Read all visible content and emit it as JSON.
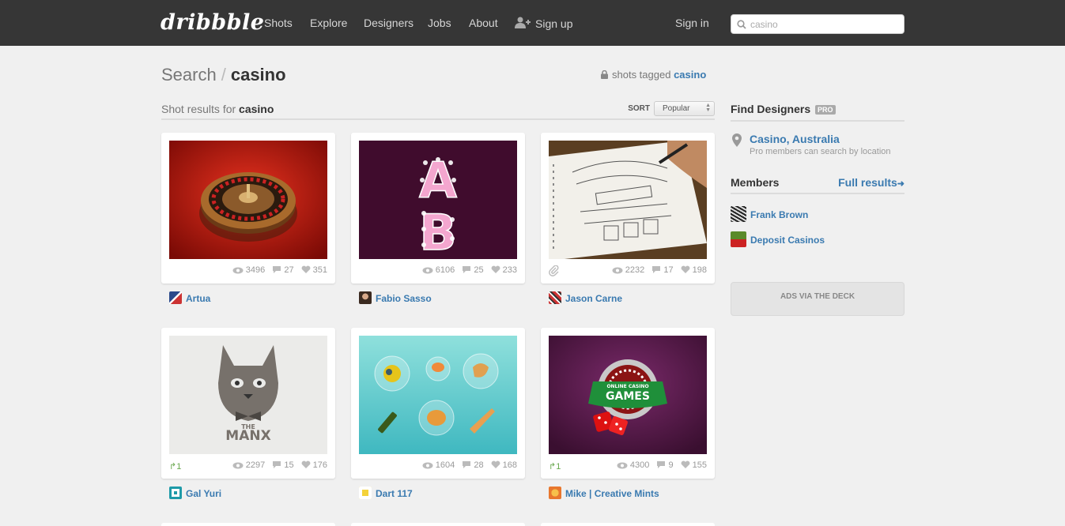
{
  "header": {
    "logo": "dribbble",
    "nav": [
      "Shots",
      "Explore",
      "Designers",
      "Jobs",
      "About",
      "Sign up"
    ],
    "signin": "Sign in",
    "search_value": "casino",
    "icons": [
      "search-icon",
      "add-user-icon"
    ]
  },
  "page": {
    "crumb_root": "Search",
    "crumb_sep": "/",
    "crumb_current": "casino",
    "tagged_prefix": "shots tagged",
    "tagged_tag": "casino",
    "results_prefix": "Shot results for",
    "results_query": "casino",
    "sort_label": "SORT",
    "sort_value": "Popular"
  },
  "shots": [
    {
      "views": "3496",
      "comments": "27",
      "likes": "351",
      "author": "Artua",
      "rebound": "",
      "attachment": false
    },
    {
      "views": "6106",
      "comments": "25",
      "likes": "233",
      "author": "Fabio Sasso",
      "rebound": "",
      "attachment": false
    },
    {
      "views": "2232",
      "comments": "17",
      "likes": "198",
      "author": "Jason Carne",
      "rebound": "",
      "attachment": true
    },
    {
      "views": "2297",
      "comments": "15",
      "likes": "176",
      "author": "Gal Yuri",
      "rebound": "1",
      "attachment": false
    },
    {
      "views": "1604",
      "comments": "28",
      "likes": "168",
      "author": "Dart 117",
      "rebound": "",
      "attachment": false
    },
    {
      "views": "4300",
      "comments": "9",
      "likes": "155",
      "author": "Mike | Creative Mints",
      "rebound": "1",
      "attachment": false
    }
  ],
  "thumb_text": {
    "letter_a": "A",
    "letter_b": "B",
    "manx_the": "THE",
    "manx_name": "MANX",
    "games_online": "ONLINE CASINO",
    "games_title": "GAMES"
  },
  "sidebar": {
    "find_title": "Find Designers",
    "pro_badge": "PRO",
    "location": "Casino, Australia",
    "location_note": "Pro members can search by location",
    "members_title": "Members",
    "full_results": "Full results",
    "members": [
      "Frank Brown",
      "Deposit Casinos"
    ],
    "ads": "ADS VIA THE DECK"
  },
  "colors": {
    "header_bg": "#363636",
    "link": "#3a7ab0",
    "page_bg": "#f0f0f0"
  }
}
